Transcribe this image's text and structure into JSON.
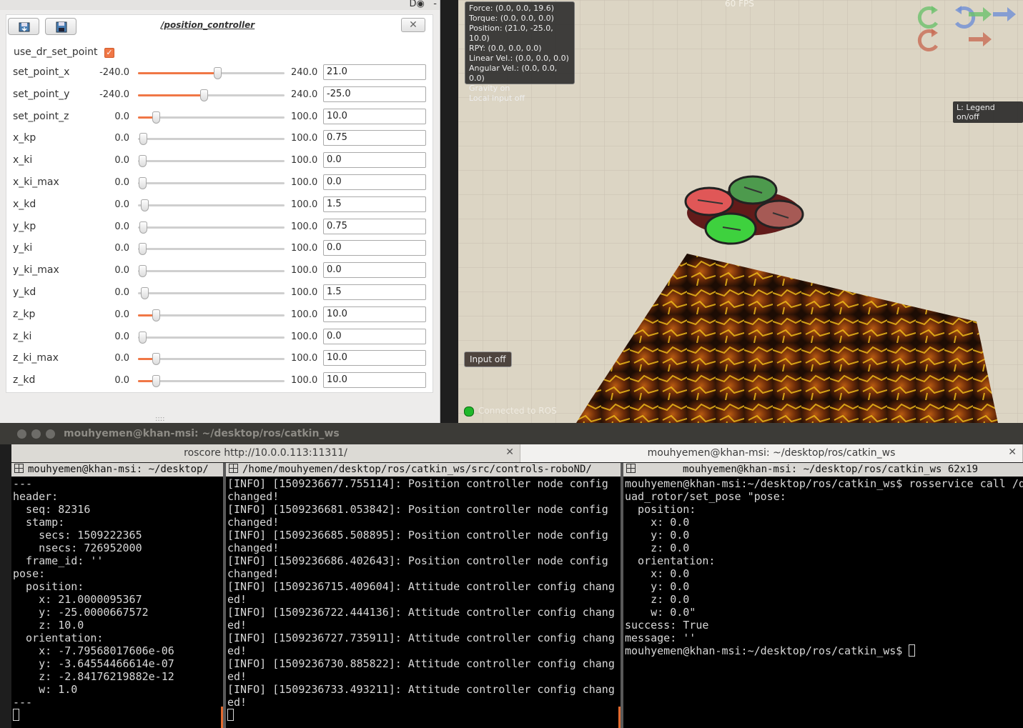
{
  "reconfigure": {
    "node_title": "/position_controller",
    "close_glyph": "✕",
    "use_dr_label": "use_dr_set_point",
    "use_dr_checked": true,
    "grip": "::::",
    "params": [
      {
        "name": "set_point_x",
        "min": "-240.0",
        "max": "240.0",
        "value": "21.0",
        "slider_fraction": 0.544
      },
      {
        "name": "set_point_y",
        "min": "-240.0",
        "max": "240.0",
        "value": "-25.0",
        "slider_fraction": 0.448
      },
      {
        "name": "set_point_z",
        "min": "0.0",
        "max": "100.0",
        "value": "10.0",
        "slider_fraction": 0.1
      },
      {
        "name": "x_kp",
        "min": "0.0",
        "max": "100.0",
        "value": "0.75",
        "slider_fraction": 0.0075
      },
      {
        "name": "x_ki",
        "min": "0.0",
        "max": "100.0",
        "value": "0.0",
        "slider_fraction": 0.0
      },
      {
        "name": "x_ki_max",
        "min": "0.0",
        "max": "100.0",
        "value": "0.0",
        "slider_fraction": 0.0
      },
      {
        "name": "x_kd",
        "min": "0.0",
        "max": "100.0",
        "value": "1.5",
        "slider_fraction": 0.015
      },
      {
        "name": "y_kp",
        "min": "0.0",
        "max": "100.0",
        "value": "0.75",
        "slider_fraction": 0.0075
      },
      {
        "name": "y_ki",
        "min": "0.0",
        "max": "100.0",
        "value": "0.0",
        "slider_fraction": 0.0
      },
      {
        "name": "y_ki_max",
        "min": "0.0",
        "max": "100.0",
        "value": "0.0",
        "slider_fraction": 0.0
      },
      {
        "name": "y_kd",
        "min": "0.0",
        "max": "100.0",
        "value": "1.5",
        "slider_fraction": 0.015
      },
      {
        "name": "z_kp",
        "min": "0.0",
        "max": "100.0",
        "value": "10.0",
        "slider_fraction": 0.1
      },
      {
        "name": "z_ki",
        "min": "0.0",
        "max": "100.0",
        "value": "0.0",
        "slider_fraction": 0.0
      },
      {
        "name": "z_ki_max",
        "min": "0.0",
        "max": "100.0",
        "value": "10.0",
        "slider_fraction": 0.1
      },
      {
        "name": "z_kd",
        "min": "0.0",
        "max": "100.0",
        "value": "10.0",
        "slider_fraction": 0.1
      }
    ],
    "accent_color": "#f07746"
  },
  "simulator": {
    "hud_lines": [
      "Force: (0.0, 0.0, 19.6)",
      "Torque: (0.0, 0.0, 0.0)",
      "Position: (21.0, -25.0, 10.0)",
      "RPY: (0.0, 0.0, 0.0)",
      "Linear Vel.: (0.0, 0.0, 0.0)",
      "Angular Vel.: (0.0, 0.0, 0.0)",
      "Gravity on",
      "Local input off"
    ],
    "fps": "60 FPS",
    "legend_button": "L: Legend on/off",
    "input_button": "Input off",
    "ros_status": "Connected to ROS",
    "ros_status_color": "#1fb82a"
  },
  "terminal": {
    "window_title": "mouhyemen@khan-msi: ~/desktop/ros/catkin_ws",
    "tabs": [
      {
        "label": "roscore http://10.0.0.113:11311/",
        "close": "✕"
      },
      {
        "label": "mouhyemen@khan-msi: ~/desktop/ros/catkin_ws",
        "close": "✕"
      }
    ],
    "panes": [
      {
        "header": "mouhyemen@khan-msi: ~/desktop/",
        "lines": [
          "---",
          "header:",
          "  seq: 82316",
          "  stamp:",
          "    secs: 1509222365",
          "    nsecs: 726952000",
          "  frame_id: ''",
          "pose:",
          "  position:",
          "    x: 21.0000095367",
          "    y: -25.0000667572",
          "    z: 10.0",
          "  orientation:",
          "    x: -7.79568017606e-06",
          "    y: -3.64554466614e-07",
          "    z: -2.84176219882e-12",
          "    w: 1.0",
          "---"
        ]
      },
      {
        "header": "/home/mouhyemen/desktop/ros/catkin_ws/src/controls-roboND/",
        "lines": [
          "[INFO] [1509236677.755114]: Position controller node config",
          "changed!",
          "[INFO] [1509236681.053842]: Position controller node config",
          "changed!",
          "[INFO] [1509236685.508895]: Position controller node config",
          "changed!",
          "[INFO] [1509236686.402643]: Position controller node config",
          "changed!",
          "[INFO] [1509236715.409604]: Attitude controller config chang",
          "ed!",
          "[INFO] [1509236722.444136]: Attitude controller config chang",
          "ed!",
          "[INFO] [1509236727.735911]: Attitude controller config chang",
          "ed!",
          "[INFO] [1509236730.885822]: Attitude controller config chang",
          "ed!",
          "[INFO] [1509236733.493211]: Attitude controller config chang",
          "ed!"
        ]
      },
      {
        "header": "mouhyemen@khan-msi: ~/desktop/ros/catkin_ws 62x19",
        "lines": [
          "mouhyemen@khan-msi:~/desktop/ros/catkin_ws$ rosservice call /q",
          "uad_rotor/set_pose \"pose:",
          "  position:",
          "    x: 0.0",
          "    y: 0.0",
          "    z: 0.0",
          "  orientation:",
          "    x: 0.0",
          "    y: 0.0",
          "    z: 0.0",
          "    w: 0.0\"",
          "success: True",
          "message: ''"
        ],
        "prompt": "mouhyemen@khan-msi:~/desktop/ros/catkin_ws$ "
      }
    ]
  }
}
